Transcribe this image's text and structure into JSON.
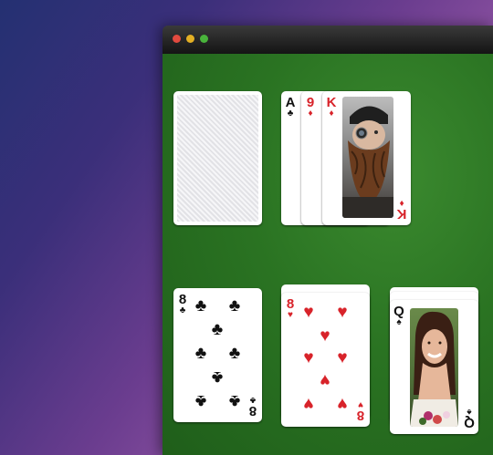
{
  "window": {
    "traffic_lights": [
      "close",
      "minimize",
      "maximize"
    ]
  },
  "colors": {
    "felt": "#2a7322",
    "red_suit": "#d8232a",
    "black_suit": "#111111"
  },
  "stock": {
    "face_down": true
  },
  "waste": {
    "cards": [
      {
        "rank": "A",
        "suit": "♣"
      },
      {
        "rank": "9",
        "suit": "♦"
      },
      {
        "rank": "K",
        "suit": "♦"
      }
    ]
  },
  "tableau": [
    {
      "rank": "8",
      "suit": "♣"
    },
    {
      "rank": "8",
      "suit": "♥"
    },
    {
      "rank": "Q",
      "suit": "♠"
    }
  ]
}
